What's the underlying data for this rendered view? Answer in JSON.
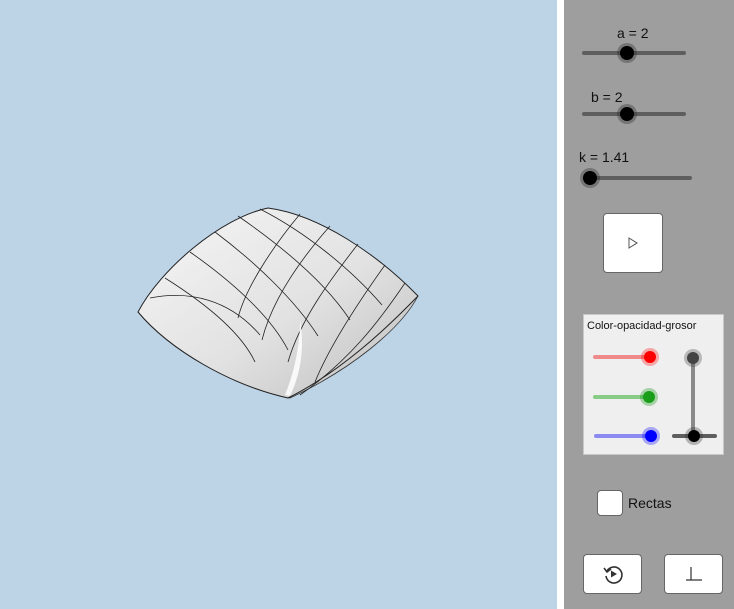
{
  "sliders": {
    "a": {
      "label": "a = 2",
      "value": 2
    },
    "b": {
      "label": "b = 2",
      "value": 2
    },
    "k": {
      "label": "k = 1.41",
      "value": 1.41
    }
  },
  "play_button": {
    "icon": "play-icon"
  },
  "color_panel": {
    "title": "Color-opacidad-grosor",
    "red": {
      "color": "#ff0000",
      "track": "#f08a8a"
    },
    "green": {
      "color": "#1a9e1a",
      "track": "#86cc86"
    },
    "blue": {
      "color": "#0000ff",
      "track": "#8a8af0"
    }
  },
  "rectas": {
    "label": "Rectas",
    "checked": false
  },
  "bottom_buttons": {
    "reset_icon": "reset-icon",
    "axes_icon": "axes-icon"
  },
  "colors": {
    "view_background": "#bdd3e6",
    "panel_background": "#9e9e9e"
  }
}
